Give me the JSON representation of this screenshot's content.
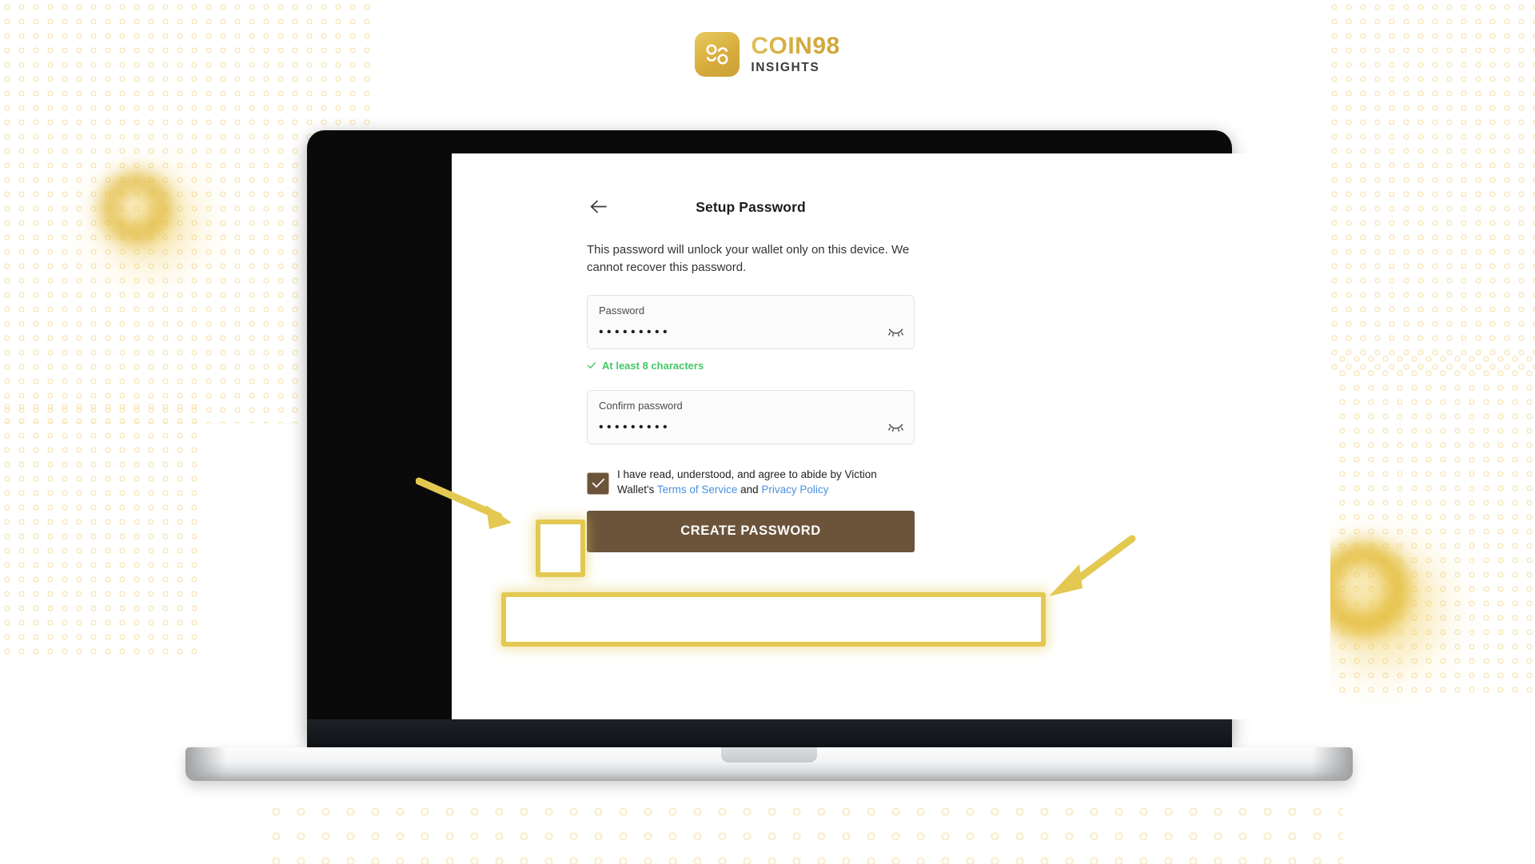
{
  "brand": {
    "logo_mark_name": "coin98-logo-mark",
    "word": "COIN98",
    "subtitle": "INSIGHTS",
    "mark_gradient_start": "#e8c960",
    "mark_gradient_end": "#c9a037"
  },
  "device": {
    "type": "laptop",
    "screen_background": "#ffffff",
    "bezel_color": "#0a0a0a",
    "base_color": "#dcdddf"
  },
  "wallet": {
    "back_icon": "arrow-left-icon",
    "title": "Setup Password",
    "description": "This password will unlock your wallet only on this device. We cannot recover this password.",
    "password_field": {
      "label": "Password",
      "value": "•••••••••",
      "masked_length": 9,
      "toggle_icon": "eye-off-icon"
    },
    "validation": {
      "icon": "check-icon",
      "text": "At least 8 characters",
      "color": "#44c767"
    },
    "confirm_field": {
      "label": "Confirm password",
      "value": "•••••••••",
      "masked_length": 9,
      "toggle_icon": "eye-off-icon"
    },
    "terms": {
      "checked": true,
      "checkbox_color": "#6b543a",
      "text_before": "I have read, understood, and agree to abide by Viction Wallet's ",
      "link_terms": "Terms of Service",
      "text_middle": " and ",
      "link_privacy": "Privacy Policy",
      "link_color": "#4a90e2"
    },
    "submit_button": {
      "label": "CREATE PASSWORD",
      "background": "#6b543a",
      "text_color": "#ffffff"
    }
  },
  "annotations": {
    "highlight_color": "#e3c951",
    "arrow_color": "#e3c951",
    "checkbox_highlight_name": "highlight-box-checkbox",
    "button_highlight_name": "highlight-box-create-password",
    "arrow_one_name": "annotation-arrow-to-checkbox",
    "arrow_two_name": "annotation-arrow-to-button"
  },
  "background": {
    "pattern": "ring-dots",
    "pattern_color": "#f8e9bd",
    "ring_color": "#dfb634",
    "page_background": "#ffffff"
  }
}
